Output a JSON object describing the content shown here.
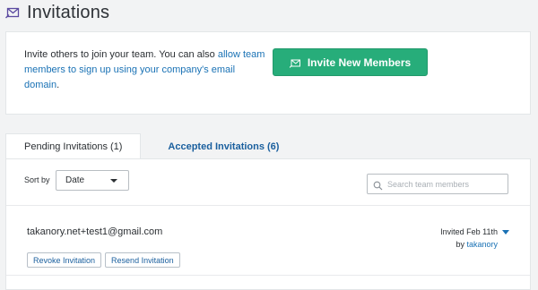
{
  "header": {
    "title": "Invitations",
    "icon": "invitation-envelope-icon"
  },
  "invite_card": {
    "text_plain": "Invite others to join your team. You can also ",
    "text_link": "allow team members to sign up using your company's email domain",
    "text_end": ".",
    "button_label": "Invite New Members",
    "button_icon": "envelope-icon"
  },
  "tabs": [
    {
      "label": "Pending Invitations",
      "count": "(1)",
      "active": true
    },
    {
      "label": "Accepted Invitations",
      "count": "(6)",
      "active": false
    }
  ],
  "toolbar": {
    "sort_label": "Sort by",
    "sort_value": "Date",
    "search_placeholder": "Search team members"
  },
  "invitations": [
    {
      "email": "takanory.net+test1@gmail.com",
      "invited_text": "Invited Feb 11th",
      "by_prefix": "by ",
      "by_name": "takanory",
      "actions": [
        "Revoke Invitation",
        "Resend Invitation"
      ]
    }
  ],
  "colors": {
    "accent_green": "#27ad7a",
    "link_blue": "#1a72b5",
    "tab_blue": "#1a5f9e",
    "background": "#f2f3f4"
  }
}
